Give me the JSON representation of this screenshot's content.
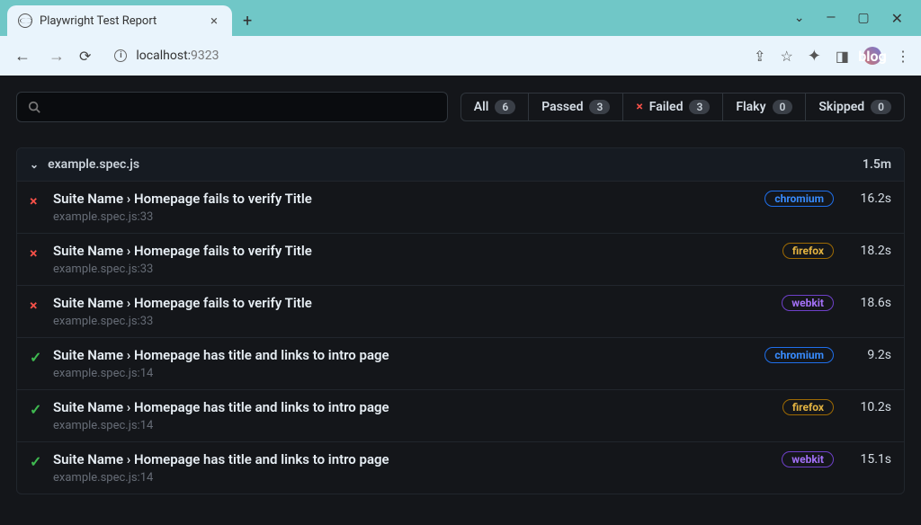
{
  "window": {
    "tab_title": "Playwright Test Report",
    "address": {
      "host": "localhost:",
      "port": "9323"
    }
  },
  "filters": {
    "all": {
      "label": "All",
      "count": "6"
    },
    "passed": {
      "label": "Passed",
      "count": "3"
    },
    "failed": {
      "label": "Failed",
      "count": "3"
    },
    "flaky": {
      "label": "Flaky",
      "count": "0"
    },
    "skipped": {
      "label": "Skipped",
      "count": "0"
    }
  },
  "file": {
    "name": "example.spec.js",
    "duration": "1.5m"
  },
  "tests": [
    {
      "status": "fail",
      "title": "Suite Name › Homepage fails to verify Title",
      "location": "example.spec.js:33",
      "browser": "chromium",
      "time": "16.2s"
    },
    {
      "status": "fail",
      "title": "Suite Name › Homepage fails to verify Title",
      "location": "example.spec.js:33",
      "browser": "firefox",
      "time": "18.2s"
    },
    {
      "status": "fail",
      "title": "Suite Name › Homepage fails to verify Title",
      "location": "example.spec.js:33",
      "browser": "webkit",
      "time": "18.6s"
    },
    {
      "status": "pass",
      "title": "Suite Name › Homepage has title and links to intro page",
      "location": "example.spec.js:14",
      "browser": "chromium",
      "time": "9.2s"
    },
    {
      "status": "pass",
      "title": "Suite Name › Homepage has title and links to intro page",
      "location": "example.spec.js:14",
      "browser": "firefox",
      "time": "10.2s"
    },
    {
      "status": "pass",
      "title": "Suite Name › Homepage has title and links to intro page",
      "location": "example.spec.js:14",
      "browser": "webkit",
      "time": "15.1s"
    }
  ]
}
